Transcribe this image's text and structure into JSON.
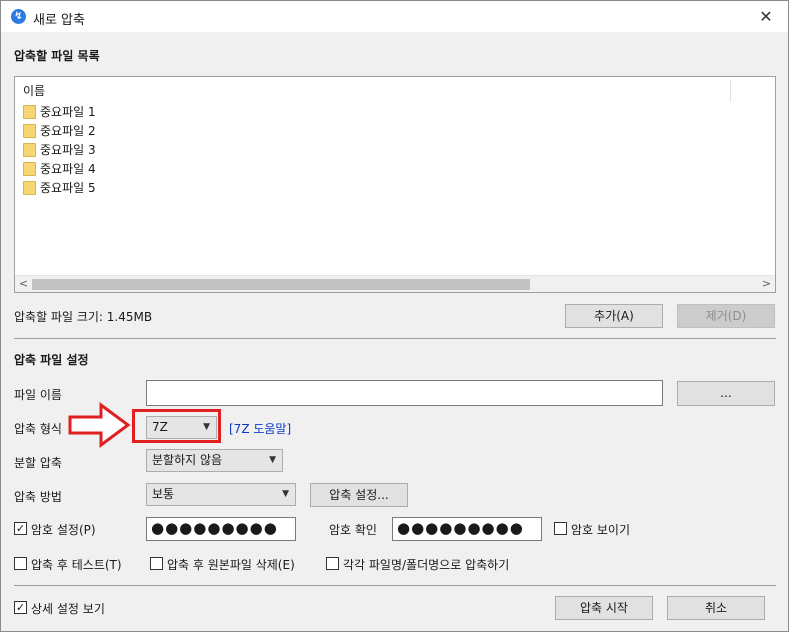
{
  "window": {
    "title": "새로 압축",
    "close_glyph": "✕",
    "app_icon_glyph": "↯"
  },
  "filelist_section": {
    "title": "압축할 파일 목록",
    "column_name": "이름",
    "items": [
      "중요파일 1",
      "중요파일 2",
      "중요파일 3",
      "중요파일 4",
      "중요파일 5"
    ],
    "scroll_left": "<",
    "scroll_right": ">"
  },
  "size_info": {
    "label": "압축할 파일 크기: 1.45MB",
    "add_button": "추가(A)",
    "remove_button": "제거(D)"
  },
  "settings": {
    "title": "압축 파일 설정",
    "filename_label": "파일 이름",
    "browse_button": "...",
    "format_label": "압축 형식",
    "format_value": "7Z",
    "format_help_link": "[7Z 도움말]",
    "split_label": "분할 압축",
    "split_value": "분할하지 않음",
    "method_label": "압축 방법",
    "method_value": "보통",
    "method_settings_button": "압축 설정...",
    "password_checkbox": "암호 설정(P)",
    "password_value": "●●●●●●●●●",
    "confirm_label": "암호 확인",
    "confirm_value": "●●●●●●●●●",
    "show_password_checkbox": "암호 보이기",
    "test_after_checkbox": "압축 후 테스트(T)",
    "delete_original_checkbox": "압축 후 원본파일 삭제(E)",
    "each_file_checkbox": "각각 파일명/폴더명으로 압축하기",
    "check_glyph": "✓"
  },
  "footer": {
    "detail_checkbox": "상세 설정 보기",
    "start_button": "압축 시작",
    "cancel_button": "취소"
  },
  "colors": {
    "annotation_red": "#e02020",
    "link_blue": "#0b3bc2",
    "folder_yellow": "#f7d774"
  }
}
